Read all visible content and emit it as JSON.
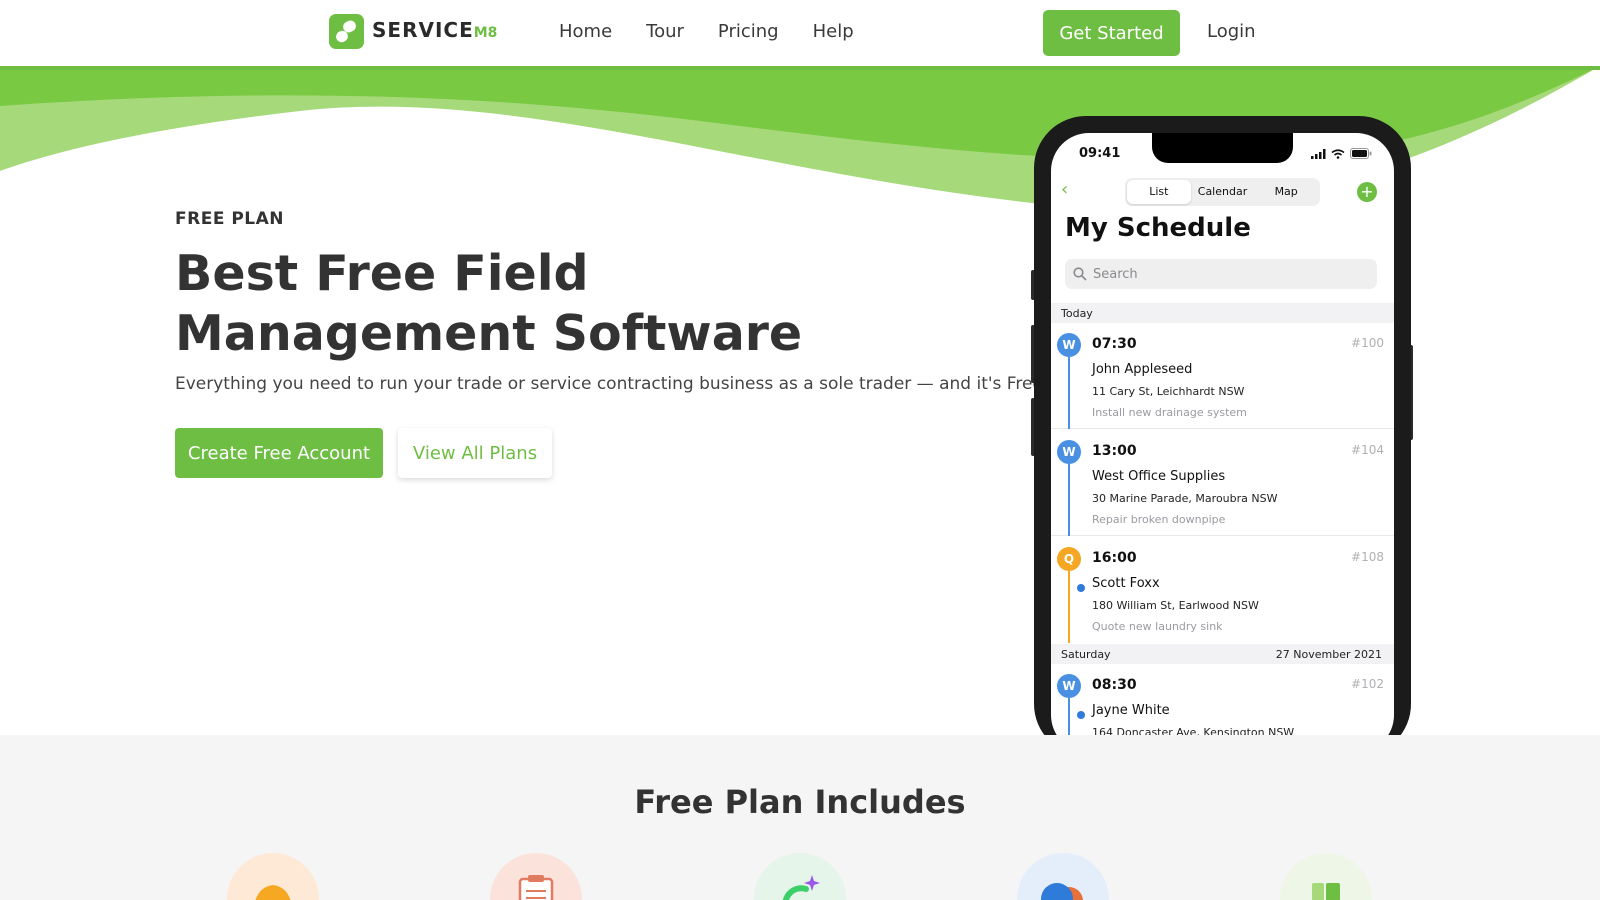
{
  "nav": {
    "logo_text": "SERVICE",
    "logo_suffix": "M8",
    "links": [
      "Home",
      "Tour",
      "Pricing",
      "Help"
    ],
    "cta_label": "Get Started",
    "login_label": "Login"
  },
  "hero": {
    "kicker": "FREE PLAN",
    "headline": "Best Free Field Management Software",
    "subline": "Everything you need to run your trade or service contracting business as a sole trader — and it's Free!",
    "primary_button": "Create Free Account",
    "secondary_button": "View All Plans"
  },
  "phone": {
    "status_time": "09:41",
    "tabs": [
      "List",
      "Calendar",
      "Map"
    ],
    "active_tab": "List",
    "title": "My Schedule",
    "search_placeholder": "Search",
    "sections": [
      {
        "label": "Today",
        "date": "",
        "jobs": [
          {
            "badge": "W",
            "time": "07:30",
            "id": "#100",
            "name": "John Appleseed",
            "address": "11 Cary St, Leichhardt NSW",
            "description": "Install new drainage system",
            "color": "#4a90e2",
            "dot": false
          },
          {
            "badge": "W",
            "time": "13:00",
            "id": "#104",
            "name": "West Office Supplies",
            "address": "30 Marine Parade, Maroubra NSW",
            "description": "Repair broken downpipe",
            "color": "#4a90e2",
            "dot": false
          },
          {
            "badge": "Q",
            "time": "16:00",
            "id": "#108",
            "name": "Scott Foxx",
            "address": "180 William St, Earlwood NSW",
            "description": "Quote new laundry sink",
            "color": "#f5a623",
            "dot": true
          }
        ]
      },
      {
        "label": "Saturday",
        "date": "27 November 2021",
        "jobs": [
          {
            "badge": "W",
            "time": "08:30",
            "id": "#102",
            "name": "Jayne White",
            "address": "164 Doncaster Ave, Kensington NSW",
            "description": "",
            "color": "#4a90e2",
            "dot": true
          }
        ]
      }
    ]
  },
  "features": {
    "title": "Free Plan Includes",
    "icons": [
      "bell-icon",
      "clipboard-icon",
      "sparkle-icon",
      "chat-bubbles-icon",
      "blocks-icon"
    ]
  },
  "colors": {
    "brand_green": "#6fbe44",
    "wave_light": "#a6d97a",
    "wave_dark": "#7ac943"
  }
}
